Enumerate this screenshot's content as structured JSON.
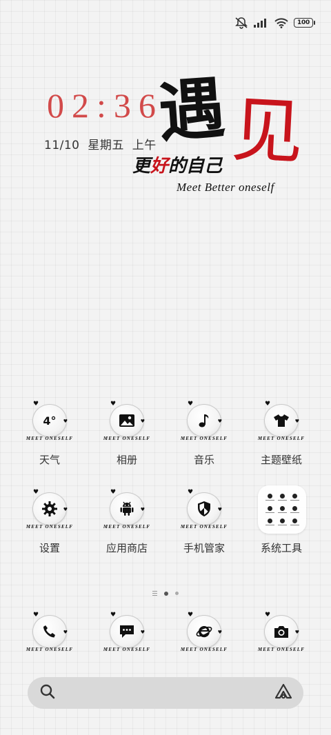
{
  "status_bar": {
    "battery_level": "100",
    "icons": [
      "mute-bell-icon",
      "signal-icon",
      "wifi-icon",
      "battery-icon"
    ]
  },
  "clock_widget": {
    "time": "02:36",
    "date": "11/10 星期五 上午",
    "art_title_char_1": "遇",
    "art_title_char_2": "见",
    "slogan_black_1": "更",
    "slogan_red": "好",
    "slogan_black_2": "的自己",
    "english_tagline": "Meet Better oneself"
  },
  "apps_row1": [
    {
      "label": "天气",
      "icon": "weather-icon",
      "glyph": "4°"
    },
    {
      "label": "相册",
      "icon": "gallery-icon"
    },
    {
      "label": "音乐",
      "icon": "music-icon"
    },
    {
      "label": "主题壁纸",
      "icon": "theme-shirt-icon"
    }
  ],
  "apps_row2": [
    {
      "label": "设置",
      "icon": "settings-gear-icon"
    },
    {
      "label": "应用商店",
      "icon": "android-store-icon"
    },
    {
      "label": "手机管家",
      "icon": "security-shield-icon"
    },
    {
      "label": "系统工具",
      "icon": "folder-icon"
    }
  ],
  "dock": [
    {
      "icon": "phone-icon"
    },
    {
      "icon": "messages-icon"
    },
    {
      "icon": "browser-icon"
    },
    {
      "icon": "camera-icon"
    }
  ],
  "icon_wordmark": "MEET ONESELF",
  "pager": {
    "pages": 2,
    "active": 1
  },
  "search_bar": {
    "placeholder": ""
  },
  "colors": {
    "accent_red": "#c8141c",
    "clock_red": "#d24a4a",
    "background": "#f3f3f3"
  }
}
